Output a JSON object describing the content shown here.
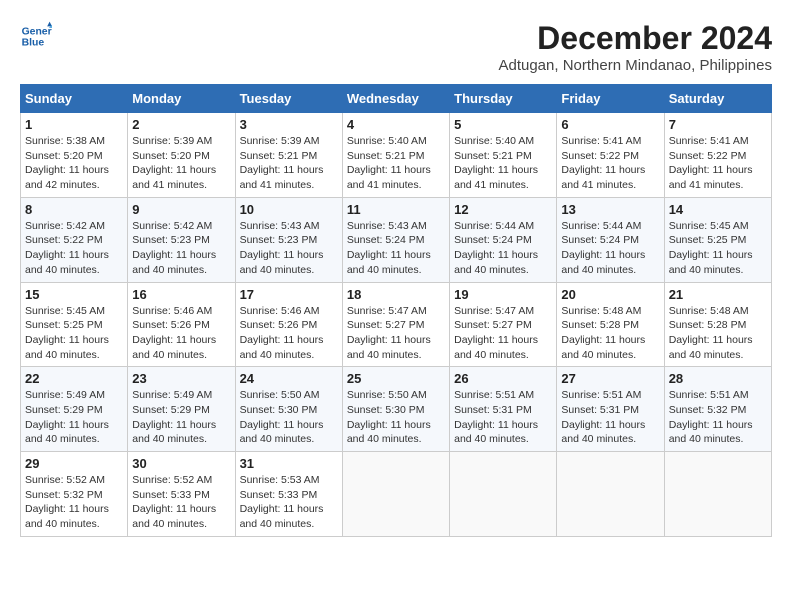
{
  "header": {
    "logo_line1": "General",
    "logo_line2": "Blue",
    "month_title": "December 2024",
    "location": "Adtugan, Northern Mindanao, Philippines"
  },
  "weekdays": [
    "Sunday",
    "Monday",
    "Tuesday",
    "Wednesday",
    "Thursday",
    "Friday",
    "Saturday"
  ],
  "weeks": [
    [
      {
        "day": 1,
        "sunrise": "5:38 AM",
        "sunset": "5:20 PM",
        "daylight": "11 hours and 42 minutes."
      },
      {
        "day": 2,
        "sunrise": "5:39 AM",
        "sunset": "5:20 PM",
        "daylight": "11 hours and 41 minutes."
      },
      {
        "day": 3,
        "sunrise": "5:39 AM",
        "sunset": "5:21 PM",
        "daylight": "11 hours and 41 minutes."
      },
      {
        "day": 4,
        "sunrise": "5:40 AM",
        "sunset": "5:21 PM",
        "daylight": "11 hours and 41 minutes."
      },
      {
        "day": 5,
        "sunrise": "5:40 AM",
        "sunset": "5:21 PM",
        "daylight": "11 hours and 41 minutes."
      },
      {
        "day": 6,
        "sunrise": "5:41 AM",
        "sunset": "5:22 PM",
        "daylight": "11 hours and 41 minutes."
      },
      {
        "day": 7,
        "sunrise": "5:41 AM",
        "sunset": "5:22 PM",
        "daylight": "11 hours and 41 minutes."
      }
    ],
    [
      {
        "day": 8,
        "sunrise": "5:42 AM",
        "sunset": "5:22 PM",
        "daylight": "11 hours and 40 minutes."
      },
      {
        "day": 9,
        "sunrise": "5:42 AM",
        "sunset": "5:23 PM",
        "daylight": "11 hours and 40 minutes."
      },
      {
        "day": 10,
        "sunrise": "5:43 AM",
        "sunset": "5:23 PM",
        "daylight": "11 hours and 40 minutes."
      },
      {
        "day": 11,
        "sunrise": "5:43 AM",
        "sunset": "5:24 PM",
        "daylight": "11 hours and 40 minutes."
      },
      {
        "day": 12,
        "sunrise": "5:44 AM",
        "sunset": "5:24 PM",
        "daylight": "11 hours and 40 minutes."
      },
      {
        "day": 13,
        "sunrise": "5:44 AM",
        "sunset": "5:24 PM",
        "daylight": "11 hours and 40 minutes."
      },
      {
        "day": 14,
        "sunrise": "5:45 AM",
        "sunset": "5:25 PM",
        "daylight": "11 hours and 40 minutes."
      }
    ],
    [
      {
        "day": 15,
        "sunrise": "5:45 AM",
        "sunset": "5:25 PM",
        "daylight": "11 hours and 40 minutes."
      },
      {
        "day": 16,
        "sunrise": "5:46 AM",
        "sunset": "5:26 PM",
        "daylight": "11 hours and 40 minutes."
      },
      {
        "day": 17,
        "sunrise": "5:46 AM",
        "sunset": "5:26 PM",
        "daylight": "11 hours and 40 minutes."
      },
      {
        "day": 18,
        "sunrise": "5:47 AM",
        "sunset": "5:27 PM",
        "daylight": "11 hours and 40 minutes."
      },
      {
        "day": 19,
        "sunrise": "5:47 AM",
        "sunset": "5:27 PM",
        "daylight": "11 hours and 40 minutes."
      },
      {
        "day": 20,
        "sunrise": "5:48 AM",
        "sunset": "5:28 PM",
        "daylight": "11 hours and 40 minutes."
      },
      {
        "day": 21,
        "sunrise": "5:48 AM",
        "sunset": "5:28 PM",
        "daylight": "11 hours and 40 minutes."
      }
    ],
    [
      {
        "day": 22,
        "sunrise": "5:49 AM",
        "sunset": "5:29 PM",
        "daylight": "11 hours and 40 minutes."
      },
      {
        "day": 23,
        "sunrise": "5:49 AM",
        "sunset": "5:29 PM",
        "daylight": "11 hours and 40 minutes."
      },
      {
        "day": 24,
        "sunrise": "5:50 AM",
        "sunset": "5:30 PM",
        "daylight": "11 hours and 40 minutes."
      },
      {
        "day": 25,
        "sunrise": "5:50 AM",
        "sunset": "5:30 PM",
        "daylight": "11 hours and 40 minutes."
      },
      {
        "day": 26,
        "sunrise": "5:51 AM",
        "sunset": "5:31 PM",
        "daylight": "11 hours and 40 minutes."
      },
      {
        "day": 27,
        "sunrise": "5:51 AM",
        "sunset": "5:31 PM",
        "daylight": "11 hours and 40 minutes."
      },
      {
        "day": 28,
        "sunrise": "5:51 AM",
        "sunset": "5:32 PM",
        "daylight": "11 hours and 40 minutes."
      }
    ],
    [
      {
        "day": 29,
        "sunrise": "5:52 AM",
        "sunset": "5:32 PM",
        "daylight": "11 hours and 40 minutes."
      },
      {
        "day": 30,
        "sunrise": "5:52 AM",
        "sunset": "5:33 PM",
        "daylight": "11 hours and 40 minutes."
      },
      {
        "day": 31,
        "sunrise": "5:53 AM",
        "sunset": "5:33 PM",
        "daylight": "11 hours and 40 minutes."
      },
      null,
      null,
      null,
      null
    ]
  ]
}
